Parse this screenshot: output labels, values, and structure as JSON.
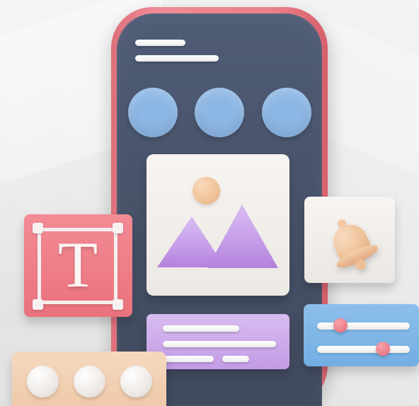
{
  "scene": {
    "background_color": "#eeeeee",
    "phone_frame_color": "#eb7f89",
    "phone_screen_color": "#4b566d"
  },
  "phone": {
    "top_line_count": 2,
    "circle_row": {
      "count": 3,
      "color": "#8db7e4"
    },
    "image_widget": {
      "icon": "image-icon",
      "background_color": "#f2efec",
      "sun_color": "#efc39d",
      "mountain_color": "#c7a2ea"
    },
    "text_widget": {
      "background_color": "#c9a5e9",
      "line_count": 3
    }
  },
  "floating_cards": {
    "text_tool": {
      "label": "T",
      "icon": "text-tool-icon",
      "background_color": "#ef808a",
      "frame_color": "#f5efee"
    },
    "notification": {
      "icon": "bell-icon",
      "background_color": "#f4f1ee",
      "bell_color": "#efc39b"
    },
    "slider_panel": {
      "icon": "sliders-icon",
      "background_color": "#7fb5e7",
      "knob_color": "#ec7f8a",
      "slider_1_level": 0.18,
      "slider_2_level": 0.72
    },
    "dots_panel": {
      "icon": "more-dots-icon",
      "background_color": "#f0ceb0",
      "dot_color": "#eeeae7",
      "dot_count": 3
    }
  }
}
